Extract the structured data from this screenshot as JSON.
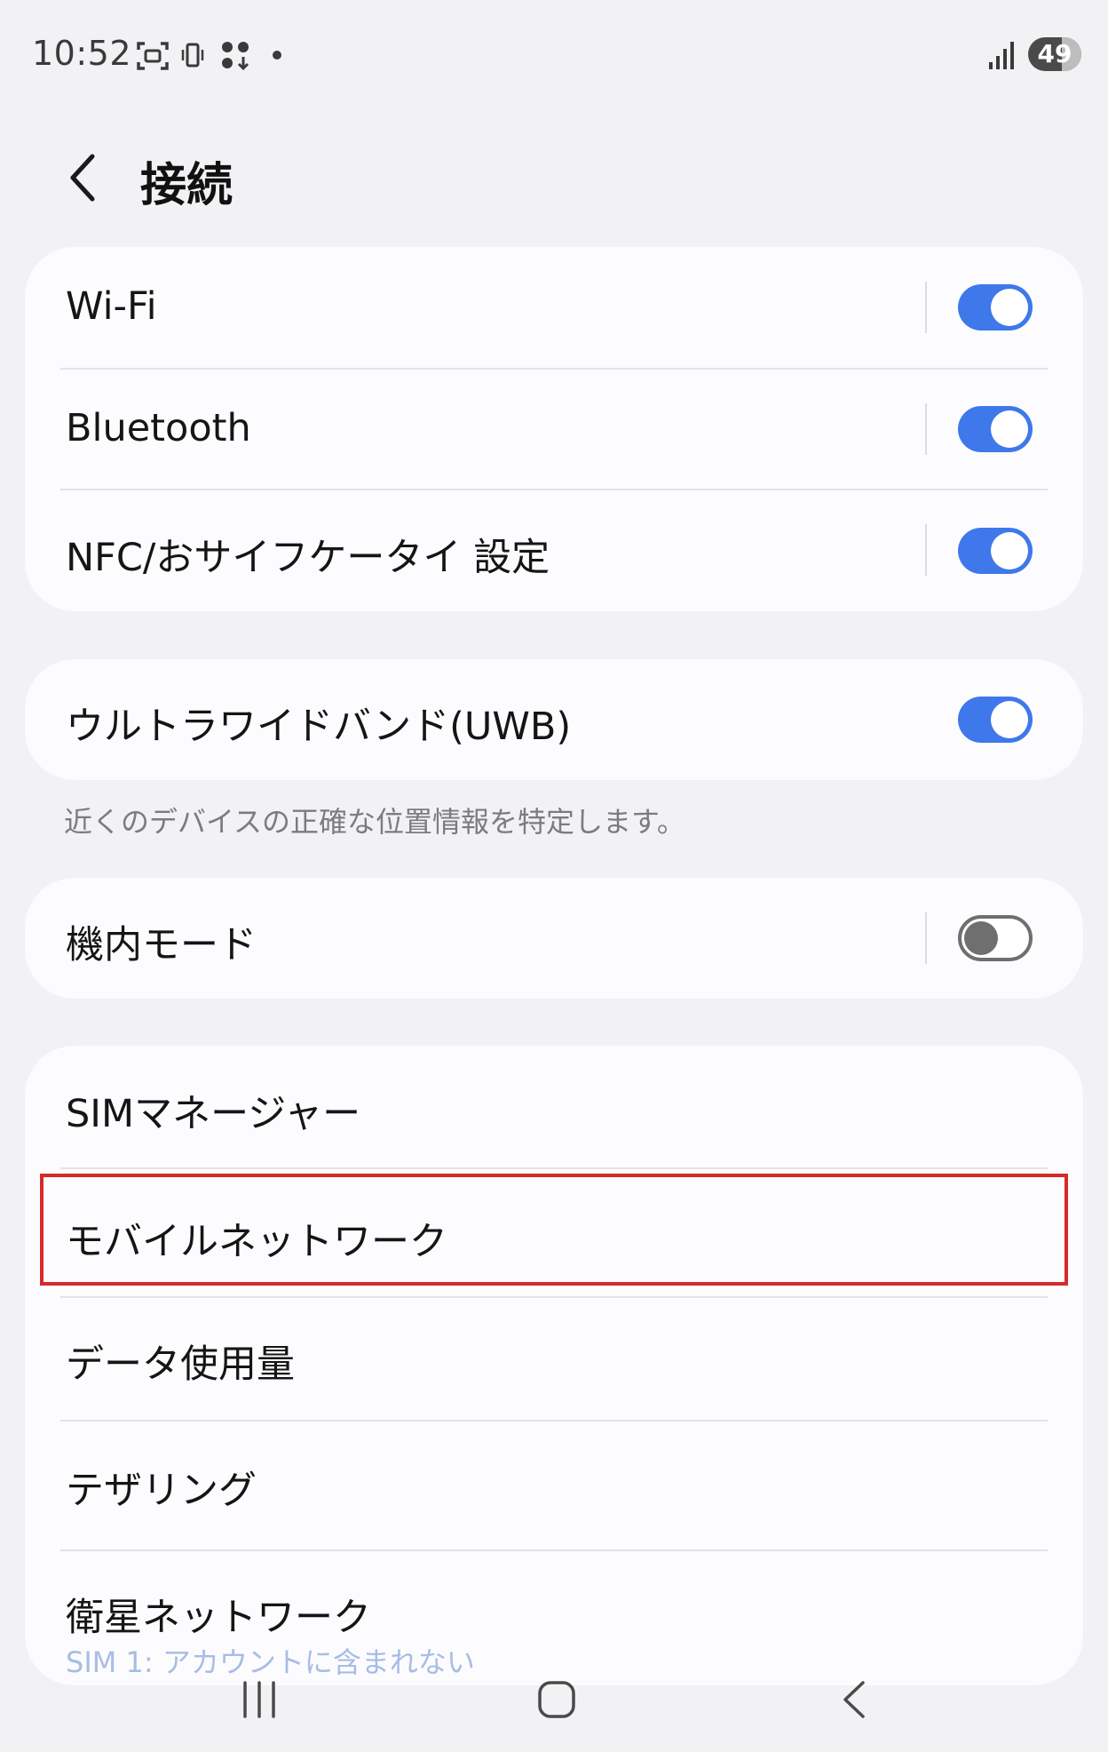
{
  "status_bar": {
    "time": "10:52",
    "battery": "49"
  },
  "header": {
    "title": "接続"
  },
  "connections": {
    "items": [
      {
        "label": "Wi-Fi",
        "enabled": true
      },
      {
        "label": "Bluetooth",
        "enabled": true
      },
      {
        "label": "NFC/おサイフケータイ 設定",
        "enabled": true
      }
    ]
  },
  "uwb": {
    "label": "ウルトラワイドバンド(UWB)",
    "enabled": true,
    "description": "近くのデバイスの正確な位置情報を特定します。"
  },
  "airplane": {
    "label": "機内モード",
    "enabled": false
  },
  "network": {
    "items": [
      {
        "label": "SIMマネージャー"
      },
      {
        "label": "モバイルネットワーク"
      },
      {
        "label": "データ使用量"
      },
      {
        "label": "テザリング"
      },
      {
        "label": "衛星ネットワーク",
        "sub": "SIM 1: アカウントに含まれない"
      }
    ]
  },
  "colors": {
    "accent": "#3e78ea",
    "highlight": "#d42a2a",
    "background": "#f2f2f5"
  }
}
